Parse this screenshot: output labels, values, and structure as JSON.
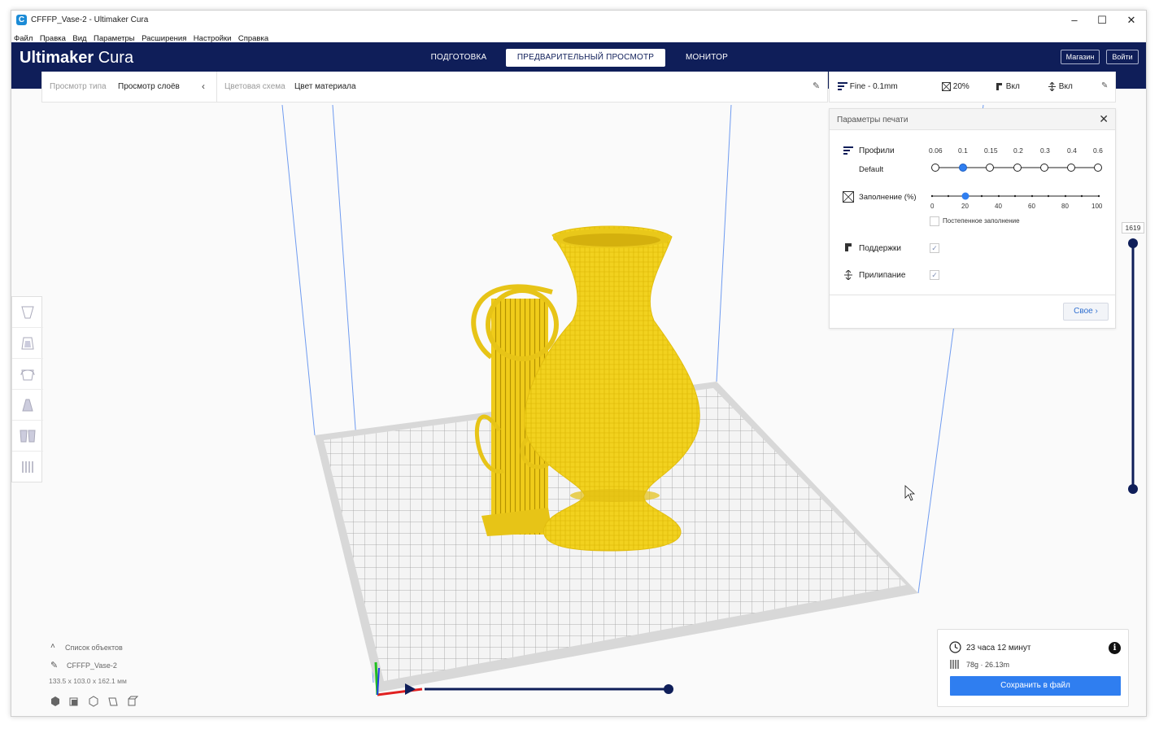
{
  "window": {
    "title": "CFFFP_Vase-2 - Ultimaker Cura",
    "controls": [
      "–",
      "☐",
      "✕"
    ]
  },
  "menu": [
    "Файл",
    "Правка",
    "Вид",
    "Параметры",
    "Расширения",
    "Настройки",
    "Справка"
  ],
  "header": {
    "logo_bold": "Ultimaker",
    "logo_light": " Cura",
    "tabs": [
      {
        "label": "ПОДГОТОВКА",
        "active": false
      },
      {
        "label": "ПРЕДВАРИТЕЛЬНЫЙ ПРОСМОТР",
        "active": true
      },
      {
        "label": "МОНИТОР",
        "active": false
      }
    ],
    "marketplace": "Магазин",
    "signin": "Войти"
  },
  "view_toolbar": {
    "view_type_label": "Просмотр типа",
    "view_type_value": "Просмотр слоёв",
    "color_scheme_label": "Цветовая схема",
    "color_scheme_value": "Цвет материала"
  },
  "print_toolbar": {
    "profile": "Fine - 0.1mm",
    "infill": "20%",
    "support": "Вкл",
    "adhesion": "Вкл"
  },
  "print_settings": {
    "title": "Параметры печати",
    "profiles_label": "Профили",
    "profile_name": "Default",
    "layer_heights": [
      "0.06",
      "0.1",
      "0.15",
      "0.2",
      "0.3",
      "0.4",
      "0.6"
    ],
    "selected_layer_height": "0.1",
    "infill_label": "Заполнение (%)",
    "infill_ticks": [
      "0",
      "20",
      "40",
      "60",
      "80",
      "100"
    ],
    "infill_value": 20,
    "gradual_infill": "Постепенное заполнение",
    "support_label": "Поддержки",
    "support_checked": true,
    "adhesion_label": "Прилипание",
    "adhesion_checked": true,
    "custom_button": "Свое"
  },
  "layer_slider": {
    "value": "1619"
  },
  "object_list": {
    "header": "Список объектов",
    "object_name": "CFFFP_Vase-2",
    "dimensions": "133.5 x 103.0 x 162.1 мм"
  },
  "job": {
    "time": "23 часа 12 минут",
    "material": "78g · 26.13m",
    "save": "Сохранить в файл"
  },
  "colors": {
    "header": "#0f1e59",
    "accent": "#2f7ef0",
    "model": "#f2d21f",
    "slider": "#0f1e59"
  }
}
